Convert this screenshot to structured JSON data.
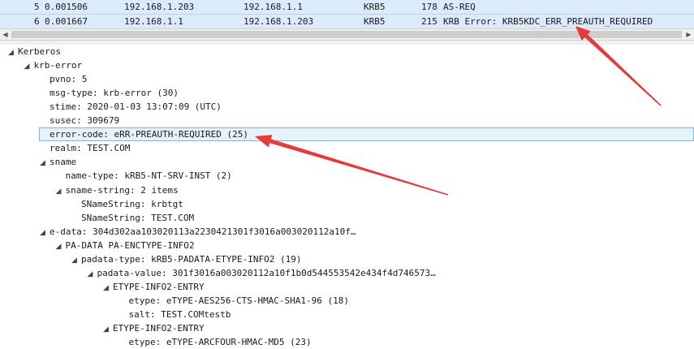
{
  "packets": [
    {
      "no": "5",
      "time": "0.001506",
      "src": "192.168.1.203",
      "dst": "192.168.1.1",
      "proto": "KRB5",
      "len": "178",
      "info": "AS-REQ"
    },
    {
      "no": "6",
      "time": "0.001667",
      "src": "192.168.1.1",
      "dst": "192.168.1.203",
      "proto": "KRB5",
      "len": "215",
      "info": "KRB Error: KRB5KDC_ERR_PREAUTH_REQUIRED"
    }
  ],
  "tree": [
    {
      "depth": 0,
      "expander": "open",
      "text": "Kerberos"
    },
    {
      "depth": 1,
      "expander": "open",
      "text": "krb-error"
    },
    {
      "depth": 2,
      "expander": "none",
      "text": "pvno: 5"
    },
    {
      "depth": 2,
      "expander": "none",
      "text": "msg-type: krb-error (30)"
    },
    {
      "depth": 2,
      "expander": "none",
      "text": "stime: 2020-01-03 13:07:09 (UTC)"
    },
    {
      "depth": 2,
      "expander": "none",
      "text": "susec: 309679"
    },
    {
      "depth": 2,
      "expander": "none",
      "text": "error-code: eRR-PREAUTH-REQUIRED (25)",
      "selected": true
    },
    {
      "depth": 2,
      "expander": "none",
      "text": "realm: TEST.COM"
    },
    {
      "depth": 2,
      "expander": "open",
      "text": "sname"
    },
    {
      "depth": 3,
      "expander": "none",
      "text": "name-type: kRB5-NT-SRV-INST (2)"
    },
    {
      "depth": 3,
      "expander": "open",
      "text": "sname-string: 2 items"
    },
    {
      "depth": 4,
      "expander": "none",
      "text": "SNameString: krbtgt"
    },
    {
      "depth": 4,
      "expander": "none",
      "text": "SNameString: TEST.COM"
    },
    {
      "depth": 2,
      "expander": "open",
      "text": "e-data: 304d302aa103020113a2230421301f3016a003020112a10f…"
    },
    {
      "depth": 3,
      "expander": "open",
      "text": "PA-DATA PA-ENCTYPE-INFO2"
    },
    {
      "depth": 4,
      "expander": "open",
      "text": "padata-type: kRB5-PADATA-ETYPE-INFO2 (19)"
    },
    {
      "depth": 5,
      "expander": "open",
      "text": "padata-value: 301f3016a003020112a10f1b0d544553542e434f4d746573…"
    },
    {
      "depth": 6,
      "expander": "open",
      "text": "ETYPE-INFO2-ENTRY"
    },
    {
      "depth": 7,
      "expander": "none",
      "text": "etype: eTYPE-AES256-CTS-HMAC-SHA1-96 (18)"
    },
    {
      "depth": 7,
      "expander": "none",
      "text": "salt: TEST.COMtestb"
    },
    {
      "depth": 6,
      "expander": "open",
      "text": "ETYPE-INFO2-ENTRY"
    },
    {
      "depth": 7,
      "expander": "none",
      "text": "etype: eTYPE-ARCFOUR-HMAC-MD5 (23)"
    }
  ],
  "annotation_color": "#e63b3b",
  "icons": {
    "expander_open": "◢",
    "scroll_left": "◀",
    "scroll_right": "▶"
  }
}
